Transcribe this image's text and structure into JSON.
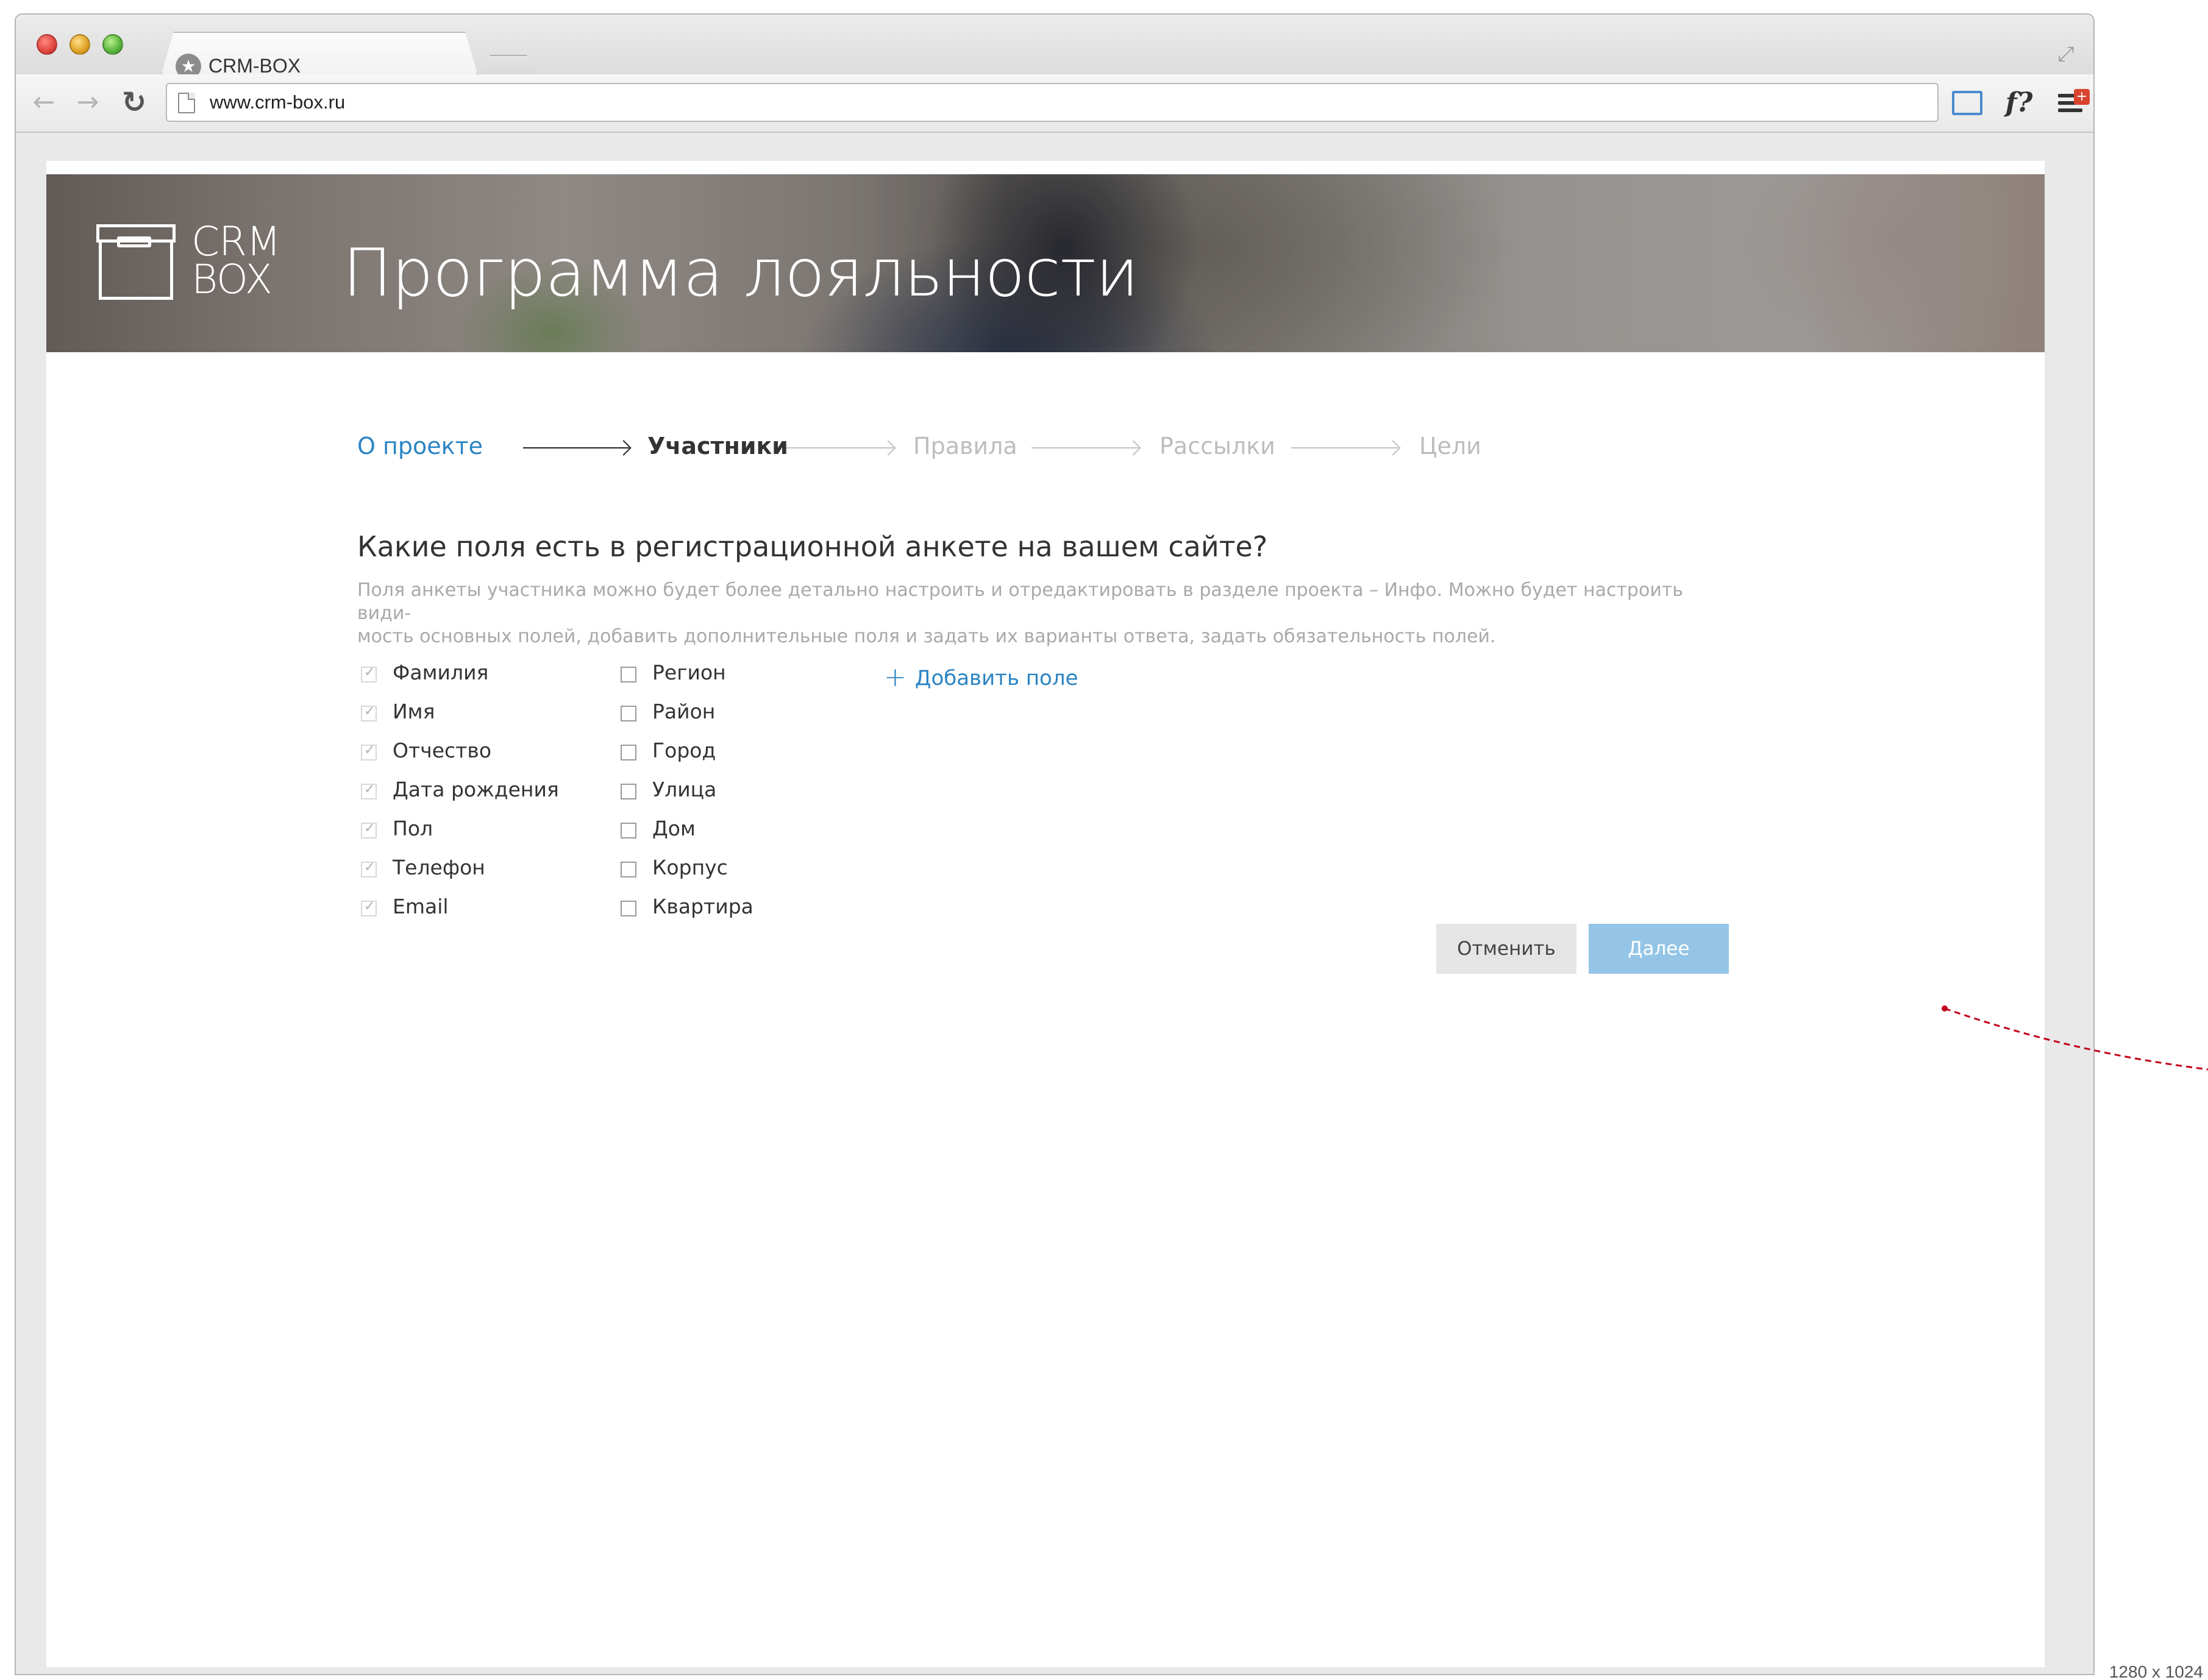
{
  "browser": {
    "tab_title": "CRM-BOX",
    "url": "www.crm-box.ru",
    "icons": [
      "back-arrow-icon",
      "forward-arrow-icon",
      "reload-icon",
      "page-icon",
      "screenshot-icon",
      "formula-icon",
      "menu-icon"
    ],
    "fq_label": "f?"
  },
  "header": {
    "logo_line1": "CRM",
    "logo_line2": "BOX",
    "title": "Программа лояльности"
  },
  "steps": [
    {
      "label": "О проекте",
      "state": "done"
    },
    {
      "label": "Участники",
      "state": "current"
    },
    {
      "label": "Правила",
      "state": "upcoming"
    },
    {
      "label": "Рассылки",
      "state": "upcoming"
    },
    {
      "label": "Цели",
      "state": "upcoming"
    }
  ],
  "form": {
    "question": "Какие поля есть в регистрационной анкете на вашем сайте?",
    "description_line1": "Поля анкеты участника можно будет более детально настроить и отредактировать в разделе проекта – Инфо. Можно будет настроить види-",
    "description_line2": "мость основных полей, добавить дополнительные поля  и задать их варианты ответа, задать обязательность полей.",
    "fields_left": [
      {
        "label": "Фамилия",
        "checked": true
      },
      {
        "label": "Имя",
        "checked": true
      },
      {
        "label": "Отчество",
        "checked": true
      },
      {
        "label": "Дата рождения",
        "checked": true
      },
      {
        "label": "Пол",
        "checked": true
      },
      {
        "label": "Телефон",
        "checked": true
      },
      {
        "label": "Email",
        "checked": true
      }
    ],
    "fields_right": [
      {
        "label": "Регион",
        "checked": false
      },
      {
        "label": "Район",
        "checked": false
      },
      {
        "label": "Город",
        "checked": false
      },
      {
        "label": "Улица",
        "checked": false
      },
      {
        "label": "Дом",
        "checked": false
      },
      {
        "label": "Корпус",
        "checked": false
      },
      {
        "label": "Квартира",
        "checked": false
      }
    ],
    "add_field_label": "Добавить поле",
    "cancel_label": "Отменить",
    "next_label": "Далее"
  },
  "colors": {
    "accent": "#2b84c3",
    "next_button": "#94c5e6",
    "cancel_button": "#e5e5e5",
    "annotation": "#c0001a"
  },
  "screen_size_label": "1280 x 1024"
}
